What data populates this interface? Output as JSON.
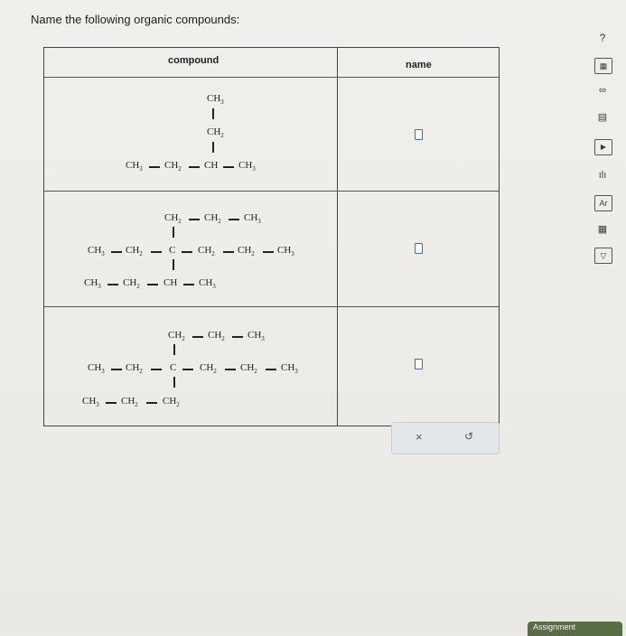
{
  "prompt": "Name the following organic compounds:",
  "table": {
    "headers": {
      "compound": "compound",
      "name": "name"
    },
    "rows": [
      {
        "labels": {
          "top1": "CH3",
          "top2": "CH2",
          "main": [
            "CH3",
            "CH2",
            "CH",
            "CH3"
          ]
        }
      },
      {
        "labels": {
          "top": [
            "CH2",
            "CH2",
            "CH3"
          ],
          "main": [
            "CH3",
            "CH2",
            "C",
            "CH2",
            "CH2",
            "CH3"
          ],
          "bottom": [
            "CH3",
            "CH2",
            "CH",
            "CH3"
          ]
        }
      },
      {
        "labels": {
          "top": [
            "CH2",
            "CH2",
            "CH3"
          ],
          "main": [
            "CH3",
            "CH2",
            "C",
            "CH2",
            "CH2",
            "CH3"
          ],
          "bottom": [
            "CH3",
            "CH2",
            "CH2"
          ]
        }
      }
    ]
  },
  "actions": {
    "clear": "×",
    "undo": "↺"
  },
  "toolbar": [
    "?",
    "▦",
    "∞",
    "▤",
    "▶",
    "ılı",
    "Ar",
    "▦",
    "▽"
  ],
  "footer": "Assignment"
}
